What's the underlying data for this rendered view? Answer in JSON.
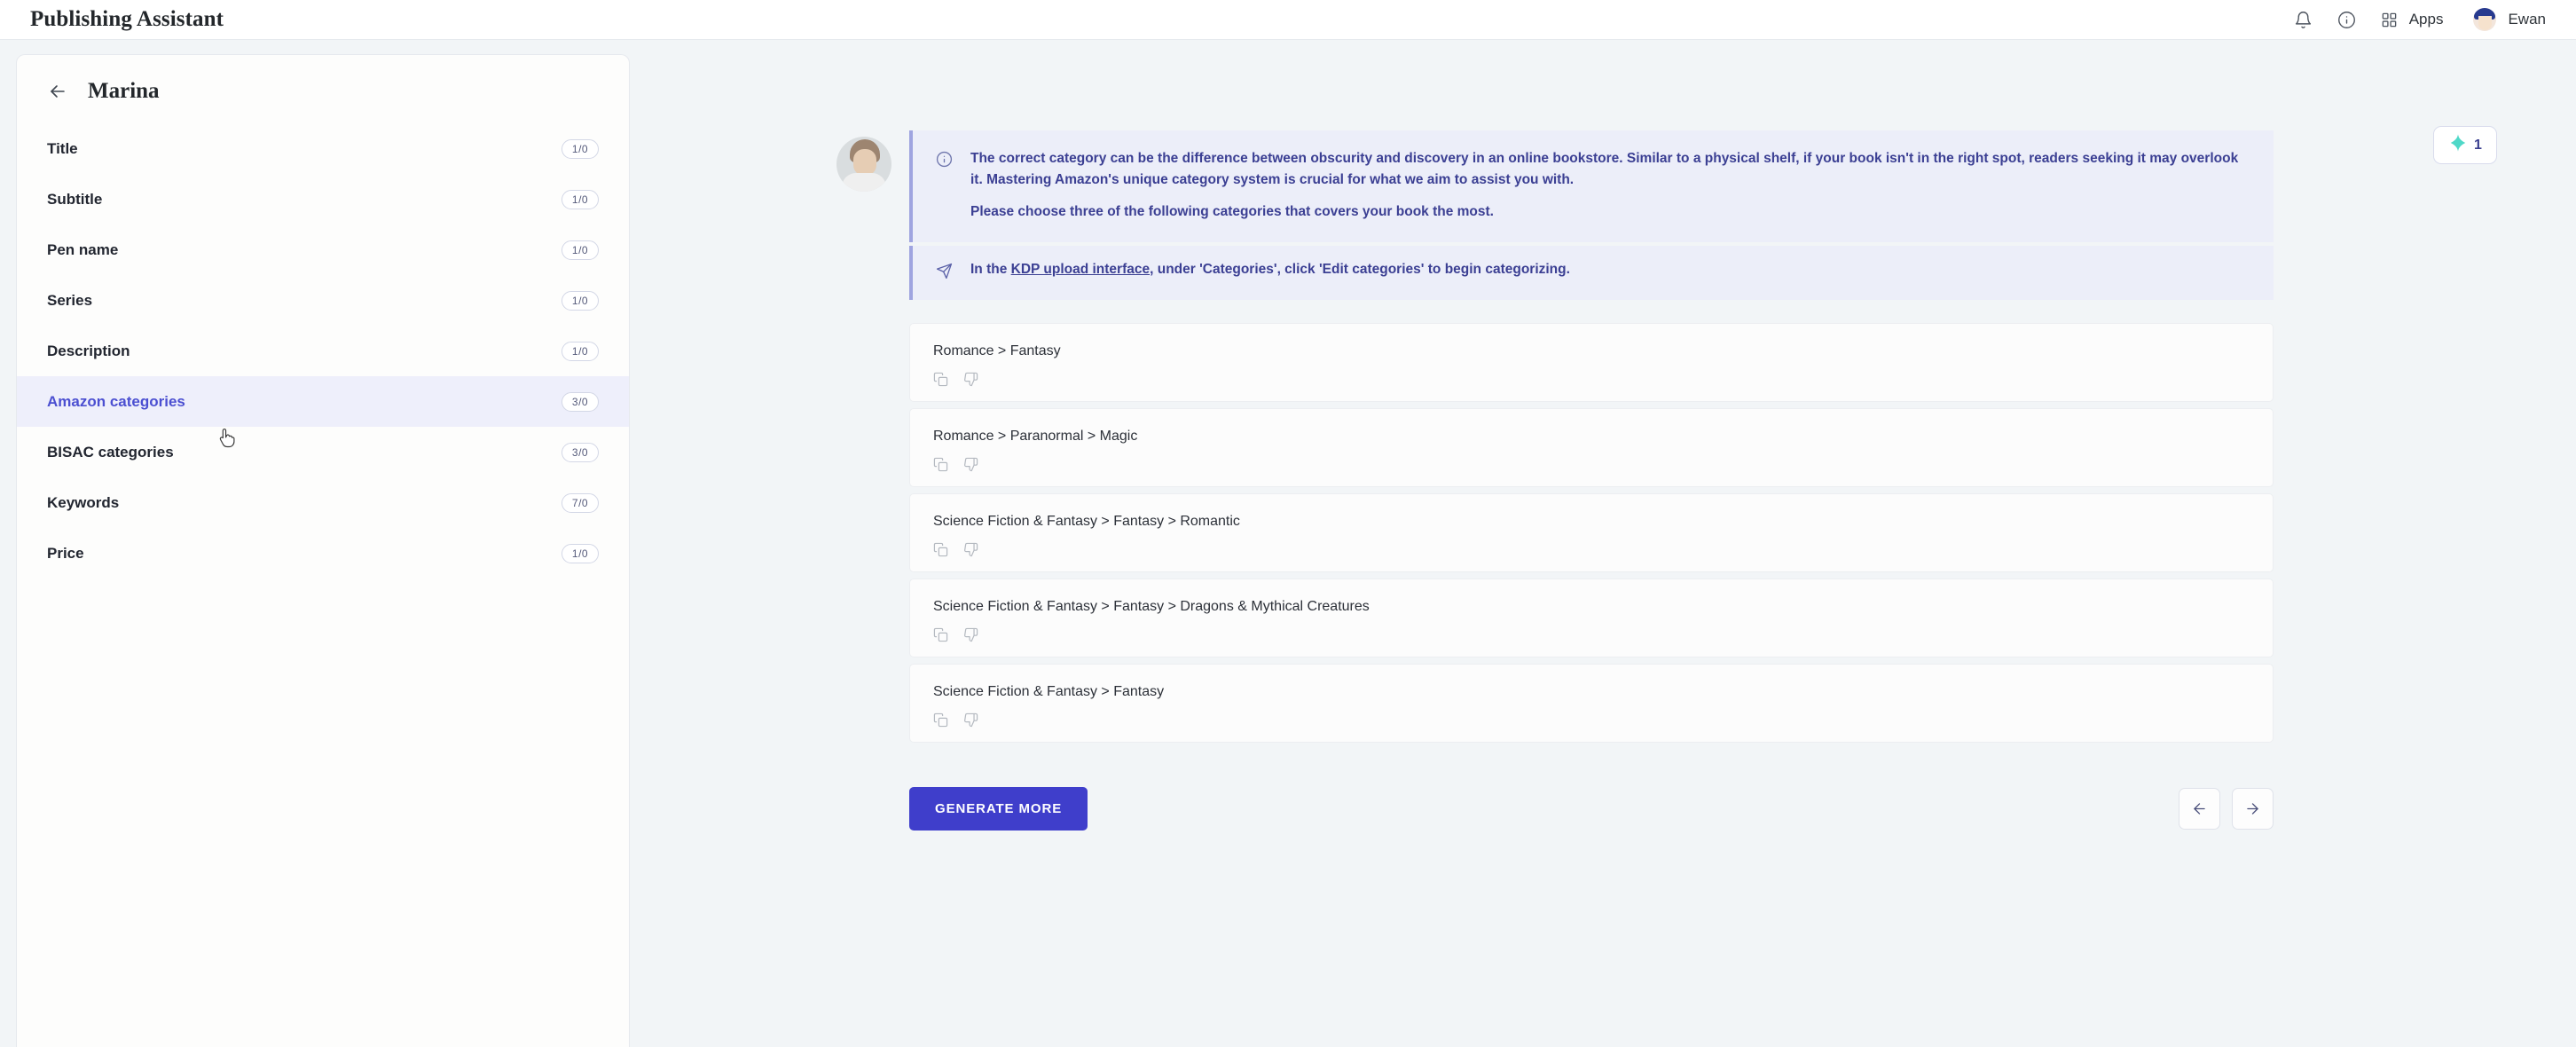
{
  "header": {
    "app_title": "Publishing Assistant",
    "apps_label": "Apps",
    "user_name": "Ewan",
    "icons": {
      "bell": "bell-icon",
      "info": "info-circle-icon",
      "grid": "grid-apps-icon"
    }
  },
  "sparkle_chip": {
    "count": "1",
    "accent": "#4fd8c8"
  },
  "sidebar": {
    "title": "Marina",
    "items": [
      {
        "label": "Title",
        "badge": "1/0",
        "active": false
      },
      {
        "label": "Subtitle",
        "badge": "1/0",
        "active": false
      },
      {
        "label": "Pen name",
        "badge": "1/0",
        "active": false
      },
      {
        "label": "Series",
        "badge": "1/0",
        "active": false
      },
      {
        "label": "Description",
        "badge": "1/0",
        "active": false
      },
      {
        "label": "Amazon categories",
        "badge": "3/0",
        "active": true
      },
      {
        "label": "BISAC categories",
        "badge": "3/0",
        "active": false
      },
      {
        "label": "Keywords",
        "badge": "7/0",
        "active": false
      },
      {
        "label": "Price",
        "badge": "1/0",
        "active": false
      }
    ]
  },
  "notice": {
    "paragraph1": "The correct category can be the difference between obscurity and discovery in an online bookstore. Similar to a physical shelf, if your book isn't in the right spot, readers seeking it may overlook it. Mastering Amazon's unique category system is crucial for what we aim to assist you with.",
    "paragraph2": "Please choose three of the following categories that covers your book the most."
  },
  "hint": {
    "prefix": "In the ",
    "link": "KDP upload interface",
    "suffix": ", under 'Categories', click 'Edit categories' to begin categorizing."
  },
  "categories": [
    {
      "path": "Romance > Fantasy"
    },
    {
      "path": "Romance > Paranormal > Magic"
    },
    {
      "path": "Science Fiction & Fantasy > Fantasy > Romantic"
    },
    {
      "path": "Science Fiction & Fantasy > Fantasy > Dragons & Mythical Creatures"
    },
    {
      "path": "Science Fiction & Fantasy > Fantasy"
    }
  ],
  "card_actions": {
    "copy": "copy-icon",
    "dislike": "thumbs-down-icon"
  },
  "footer": {
    "generate_label": "GENERATE MORE",
    "prev_label": "←",
    "next_label": "→"
  },
  "colors": {
    "accent_indigo": "#3f3ecb",
    "notice_bg": "#eceef9",
    "notice_text": "#3b3f93",
    "page_bg": "#f2f5f7",
    "active_item_bg": "#eeeffb"
  }
}
